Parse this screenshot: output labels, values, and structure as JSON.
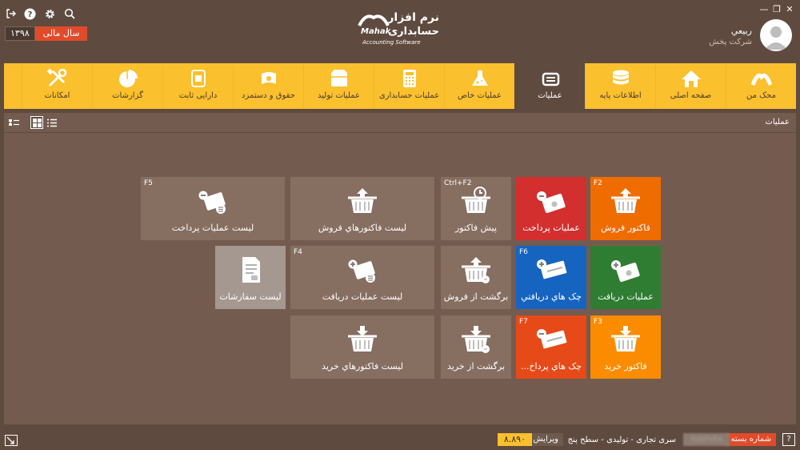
{
  "header": {
    "fiscal_year_label": "سال مالی",
    "fiscal_year_value": "۱۳۹۸",
    "logo_title": "نرم افزار",
    "logo_sub": "حسابداری",
    "logo_brand": "Mahak",
    "logo_tagline": "Accounting Software",
    "user_name": "ربيعي",
    "company_name": "شرکت پخش",
    "icons": [
      "logout-icon",
      "help-icon",
      "settings-icon",
      "search-icon"
    ]
  },
  "menu": [
    {
      "label": "محک من",
      "icon": "mahak-icon"
    },
    {
      "label": "صفحه اصلی",
      "icon": "home-icon"
    },
    {
      "label": "اطلاعات پایه",
      "icon": "database-icon"
    },
    {
      "label": "عملیات",
      "icon": "operations-icon",
      "active": true
    },
    {
      "label": "عملیات خاص",
      "icon": "flask-icon"
    },
    {
      "label": "عملیات حسابداری",
      "icon": "calculator-icon"
    },
    {
      "label": "عملیات تولید",
      "icon": "box-icon"
    },
    {
      "label": "حقوق و دستمزد",
      "icon": "money-icon"
    },
    {
      "label": "دارایی ثابت",
      "icon": "asset-icon"
    },
    {
      "label": "گزارشات",
      "icon": "pie-chart-icon"
    },
    {
      "label": "امکانات",
      "icon": "tools-icon"
    }
  ],
  "workspace": {
    "title": "عملیات"
  },
  "tiles": [
    {
      "id": "sales-invoice",
      "label": "فاکتور فروش",
      "key": "F2",
      "color": "#ef6c00",
      "icon": "basket-up-icon"
    },
    {
      "id": "payment-ops",
      "label": "عملیات پرداخت",
      "key": "",
      "color": "#d32f2f",
      "icon": "cash-minus-icon"
    },
    {
      "id": "pre-invoice",
      "label": "پیش فاکتور",
      "key": "Ctrl+F2",
      "color": "#866e61",
      "icon": "basket-clock-icon"
    },
    {
      "id": "sales-invoice-list",
      "label": "ليست فاکتورهاي فروش",
      "key": "",
      "color": "#866e61",
      "icon": "basket-up-icon"
    },
    {
      "id": "payment-ops-list",
      "label": "لیست عملیات پرداخت",
      "key": "F5",
      "color": "#866e61",
      "icon": "cash-minus-list-icon"
    },
    {
      "id": "receipt-ops",
      "label": "عملیات دریافت",
      "key": "",
      "color": "#2e7d32",
      "icon": "cash-plus-icon"
    },
    {
      "id": "received-cheques",
      "label": "چک هاي دريافتي",
      "key": "F6",
      "color": "#1565c0",
      "icon": "cheque-plus-icon"
    },
    {
      "id": "sales-return",
      "label": "برگشت از فروش",
      "key": "",
      "color": "#866e61",
      "icon": "basket-return-icon"
    },
    {
      "id": "receipt-ops-list",
      "label": "لیست عملیات دریافت",
      "key": "F4",
      "color": "#866e61",
      "icon": "cash-plus-list-icon"
    },
    {
      "id": "orders-list",
      "label": "لیست سفارشات",
      "key": "",
      "color": "#a49890",
      "icon": "document-icon"
    },
    {
      "id": "purchase-invoice",
      "label": "فاکتور خرید",
      "key": "F3",
      "color": "#fb8c00",
      "icon": "basket-down-icon"
    },
    {
      "id": "paid-cheques",
      "label": "چک هاي پرداخ...",
      "key": "F7",
      "color": "#e64a19",
      "icon": "cheque-minus-icon"
    },
    {
      "id": "purchase-return",
      "label": "برگشت از خرید",
      "key": "",
      "color": "#866e61",
      "icon": "basket-return-down-icon"
    },
    {
      "id": "purchase-invoice-list",
      "label": "ليست فاکتورهاي خريد",
      "key": "",
      "color": "#866e61",
      "icon": "basket-down-icon"
    }
  ],
  "status": {
    "series_label": "شماره بسته",
    "series_value": "RubPeRa",
    "description": "سری تجاری - تولیدی - سطح پنج",
    "version_label": "ویرایش",
    "version_value": "۸.۸۹۰"
  }
}
